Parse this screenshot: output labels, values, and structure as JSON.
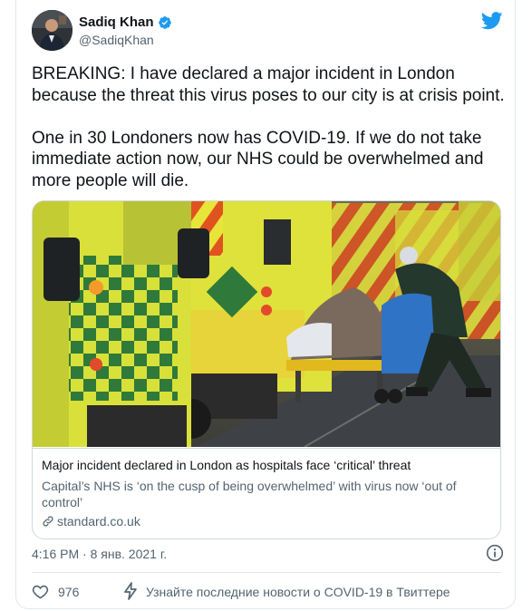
{
  "author": {
    "display_name": "Sadiq Khan",
    "handle": "@SadiqKhan",
    "verified": true
  },
  "tweet": {
    "text": "BREAKING: I have declared a major incident in London because the threat this virus poses to our city is at crisis point.\n\nOne in 30 Londoners now has COVID-19. If we do not take immediate action now, our NHS could be overwhelmed and more people will die."
  },
  "link_card": {
    "title": "Major incident declared in London as hospitals face ‘critical’ threat",
    "description": "Capital’s NHS is ‘on the cusp of being overwhelmed’ with virus now ‘out of control’",
    "domain": "standard.co.uk"
  },
  "meta": {
    "timestamp": "4:16 PM · 8 янв. 2021 г."
  },
  "actions": {
    "like_count": "976",
    "topic_prompt": "Узнайте последние новости о COVID-19 в Твиттере"
  },
  "colors": {
    "twitter_blue": "#1d9bf0",
    "text_primary": "#0f1419",
    "text_secondary": "#536471",
    "border": "#cfd9de"
  },
  "icons": [
    "verified-badge-icon",
    "twitter-bird-icon",
    "link-icon",
    "info-icon",
    "heart-icon",
    "lightning-bolt-icon"
  ]
}
